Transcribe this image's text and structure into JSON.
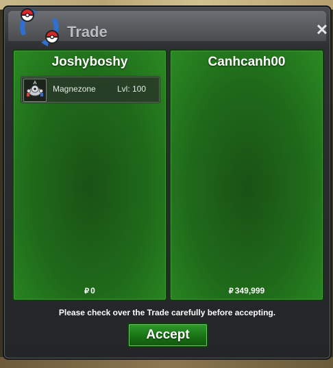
{
  "window": {
    "title": "Trade",
    "close_label": "✕"
  },
  "left_panel": {
    "player_name": "Joshyboshy",
    "items": [
      {
        "pokemon": "Magnezone",
        "level": "Lvl: 100",
        "icon": "magnezone-icon"
      }
    ],
    "money_symbol": "₽",
    "money": "0"
  },
  "right_panel": {
    "player_name": "Canhcanh00",
    "items": [],
    "money_symbol": "₽",
    "money": "349,999"
  },
  "footer": {
    "notice": "Please check over the Trade carefully before accepting.",
    "accept_label": "Accept"
  },
  "colors": {
    "panel_green": "#1f6a1a",
    "accept_green": "#1a7317",
    "window_gray": "#2d2f32"
  }
}
